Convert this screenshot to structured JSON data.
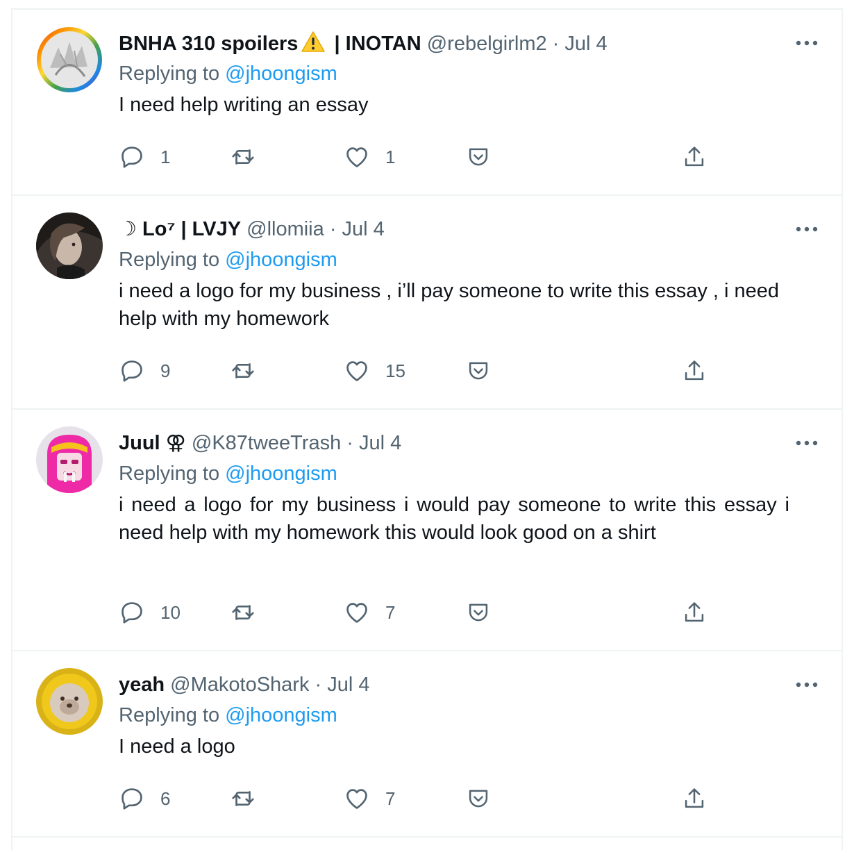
{
  "tweets": [
    {
      "name": "BNHA 310 spoilers",
      "name_suffix": " | INOTAN",
      "handle": "@rebelgirlm2",
      "date": "· Jul 4",
      "replying_prefix": "Replying to",
      "replying_to": "@jhoongism",
      "text": "I need help writing an essay",
      "replies": "1",
      "retweets": "",
      "likes": "1",
      "avatar_icon": "rainbow-ring-manga-avatar"
    },
    {
      "name": "☽ Lo⁷ | LVJY",
      "handle": "@llomiia",
      "date": "· Jul 4",
      "replying_prefix": "Replying to",
      "replying_to": "@jhoongism",
      "text": "i need a logo for my business , i’ll pay someone to write this essay , i need help with my homework",
      "replies": "9",
      "retweets": "",
      "likes": "15",
      "avatar_icon": "dark-portrait-avatar"
    },
    {
      "name": "Juul ⚢",
      "handle": "@K87tweeTrash",
      "date": "· Jul 4",
      "replying_prefix": "Replying to",
      "replying_to": "@jhoongism",
      "text": "i need a logo for my business i would pay someone to write this essay i need help with my homework this would look good on a shirt",
      "replies": "10",
      "retweets": "",
      "likes": "7",
      "avatar_icon": "pink-hair-character-avatar"
    },
    {
      "name": "yeah",
      "handle": "@MakotoShark",
      "date": "· Jul 4",
      "replying_prefix": "Replying to",
      "replying_to": "@jhoongism",
      "text": "I need a logo",
      "replies": "6",
      "retweets": "",
      "likes": "7",
      "avatar_icon": "yellow-circle-animal-avatar"
    }
  ],
  "icons": {
    "more": "more-horizontal-icon",
    "reply": "reply-bubble-icon",
    "retweet": "retweet-icon",
    "like": "heart-icon",
    "save": "pocket-save-icon",
    "share": "share-upload-icon",
    "warning": "warning-emoji-icon"
  },
  "colors": {
    "mention": "#1d9bf0",
    "meta": "#536471",
    "text": "#0f1419",
    "divider": "#eff3f4"
  }
}
